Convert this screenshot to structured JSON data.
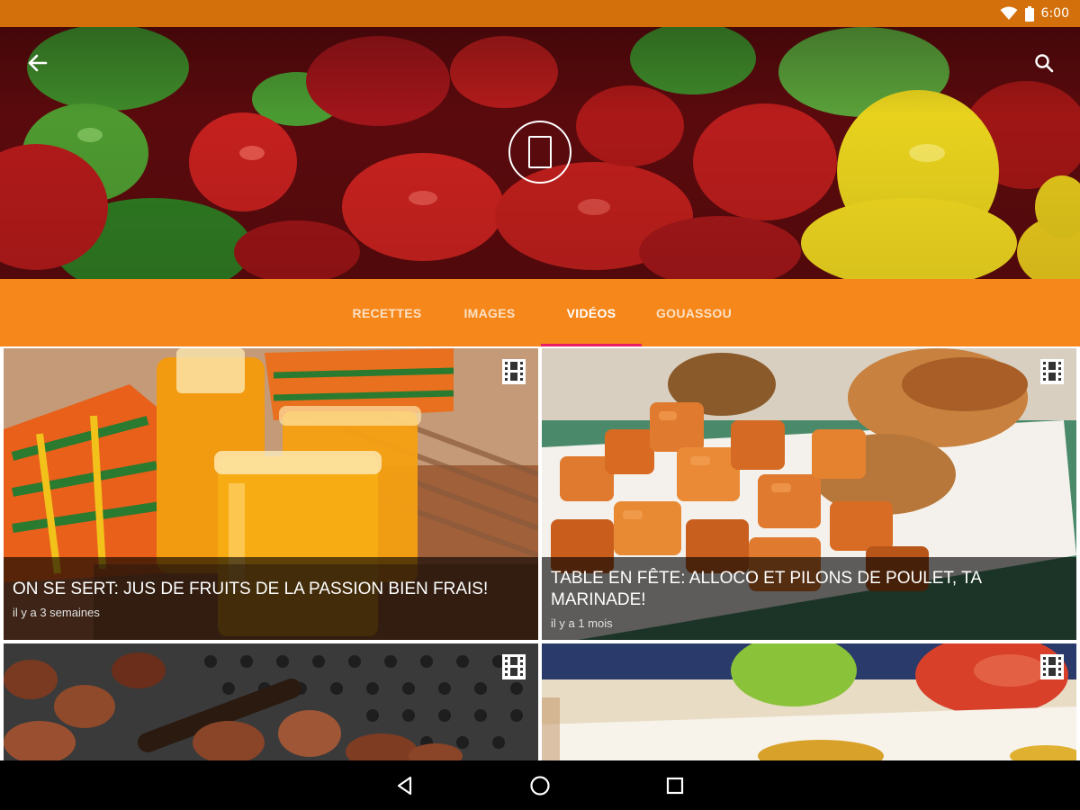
{
  "status_bar": {
    "time": "6:00"
  },
  "tabs": [
    {
      "label": "RECETTES"
    },
    {
      "label": "IMAGES"
    },
    {
      "label": "VIDÉOS"
    },
    {
      "label": "GOUASSOU"
    }
  ],
  "active_tab": "VIDÉOS",
  "videos": [
    {
      "title": "ON SE SERT: JUS DE FRUITS DE LA PASSION BIEN FRAIS!",
      "time": "il y a 3 semaines"
    },
    {
      "title": "TABLE EN FÊTE: ALLOCO ET PILONS DE POULET, TA MARINADE!",
      "time": "il y a 1 mois"
    }
  ],
  "icons": {
    "back": "arrow-left-icon",
    "search": "search-icon",
    "logo": "tablet-logo-icon",
    "video": "film-strip-icon",
    "nav_back": "triangle-back-icon",
    "nav_home": "circle-home-icon",
    "nav_recents": "square-recents-icon"
  },
  "colors": {
    "status_bar": "#d4700b",
    "tab_bar": "#f5871b",
    "tab_indicator": "#e91e63",
    "nav_bar": "#000000"
  }
}
